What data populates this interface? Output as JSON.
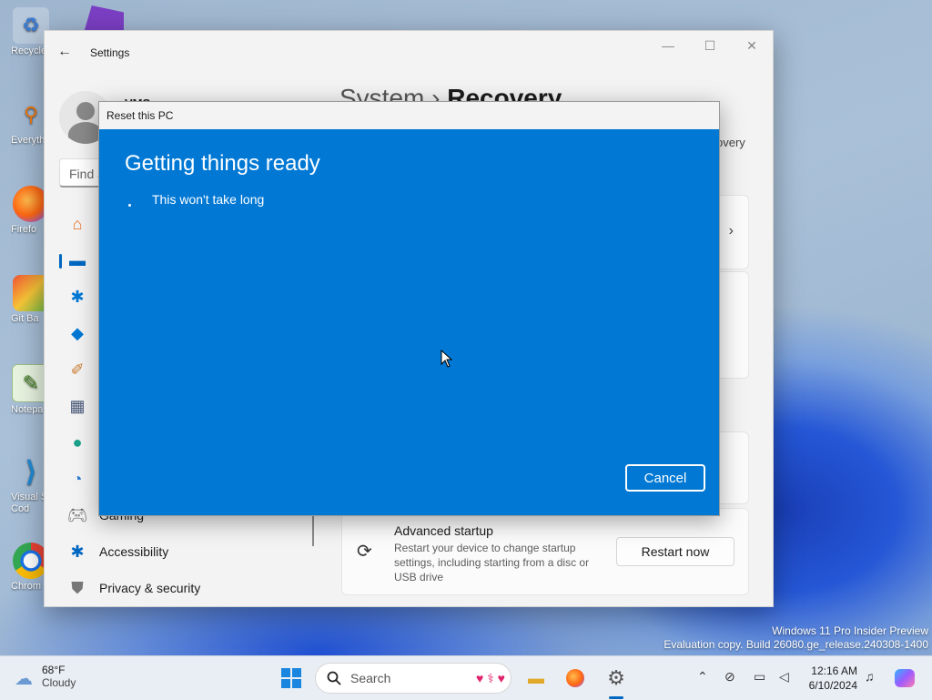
{
  "desktop": {
    "icons": [
      {
        "label": "Recycle",
        "icon": "recycle-bin-icon"
      },
      {
        "label": "Everyth",
        "icon": "everything-search-icon"
      },
      {
        "label": "Firefo",
        "icon": "firefox-icon"
      },
      {
        "label": "Git Ba",
        "icon": "git-bash-icon"
      },
      {
        "label": "Notepa",
        "icon": "notepad-icon"
      },
      {
        "label": "Visual S Cod",
        "icon": "vscode-icon"
      },
      {
        "label": "Chrom",
        "icon": "chrome-icon"
      }
    ],
    "watermark_line1": "Windows 11 Pro Insider Preview",
    "watermark_line2": "Evaluation copy. Build 26080.ge_release.240308-1400"
  },
  "settings": {
    "window_title": "Settings",
    "username": "VMS",
    "search_placeholder": "Find a",
    "breadcrumb_parent": "System",
    "breadcrumb_sep": "›",
    "breadcrumb_current": "Recovery",
    "recovery_sub": "overy",
    "nav_items": [
      {
        "label": "",
        "icon": "home-icon"
      },
      {
        "label": "",
        "icon": "system-icon"
      },
      {
        "label": "",
        "icon": "bluetooth-icon"
      },
      {
        "label": "",
        "icon": "wifi-icon"
      },
      {
        "label": "",
        "icon": "personalization-brush-icon"
      },
      {
        "label": "",
        "icon": "apps-icon"
      },
      {
        "label": "",
        "icon": "accounts-icon"
      },
      {
        "label": "",
        "icon": "time-language-icon"
      },
      {
        "label": "Gaming",
        "icon": "gaming-icon"
      },
      {
        "label": "Accessibility",
        "icon": "accessibility-icon"
      },
      {
        "label": "Privacy & security",
        "icon": "shield-icon"
      }
    ],
    "advanced_startup": {
      "title": "Advanced startup",
      "description": "Restart your device to change startup settings, including starting from a disc or USB drive",
      "button": "Restart now"
    }
  },
  "reset_dialog": {
    "title": "Reset this PC",
    "heading": "Getting things ready",
    "message": "This won't take long",
    "cancel_label": "Cancel"
  },
  "taskbar": {
    "weather_temp": "68°F",
    "weather_cond": "Cloudy",
    "search_label": "Search",
    "time": "12:16 AM",
    "date": "6/10/2024"
  },
  "colors": {
    "dialog_blue": "#0078d4",
    "accent": "#0067c0"
  }
}
